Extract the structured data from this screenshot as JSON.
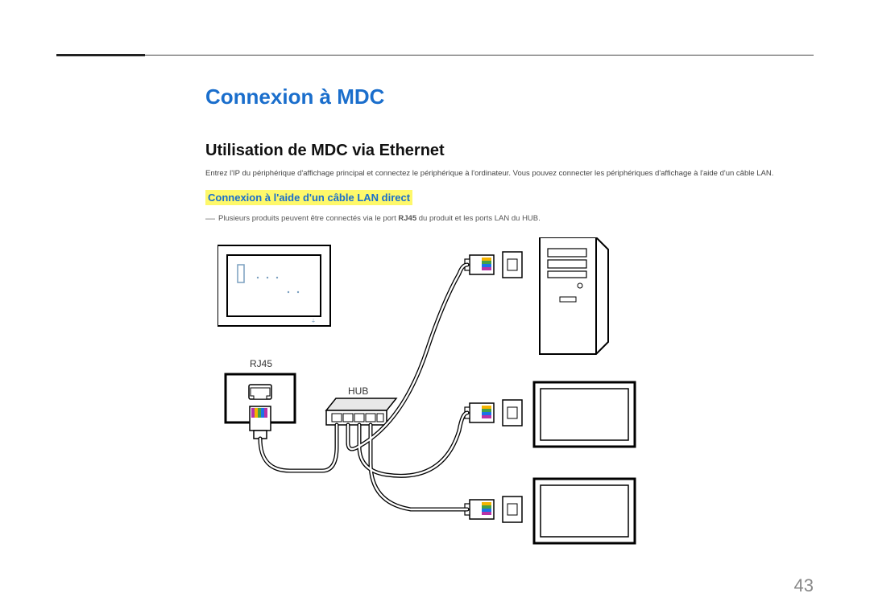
{
  "title": "Connexion à MDC",
  "subtitle": "Utilisation de MDC via Ethernet",
  "paragraph": "Entrez l'IP du périphérique d'affichage principal et connectez le périphérique à l'ordinateur. Vous pouvez connecter les périphériques d'affichage à l'aide d'un câble LAN.",
  "subheading": "Connexion à l'aide d'un câble LAN direct",
  "note_prefix": "―",
  "note_part1": "Plusieurs produits peuvent être connectés via le port ",
  "note_bold": "RJ45",
  "note_part2": " du produit et les ports LAN du HUB.",
  "labels": {
    "rj45": "RJ45",
    "hub": "HUB"
  },
  "page_number": "43"
}
